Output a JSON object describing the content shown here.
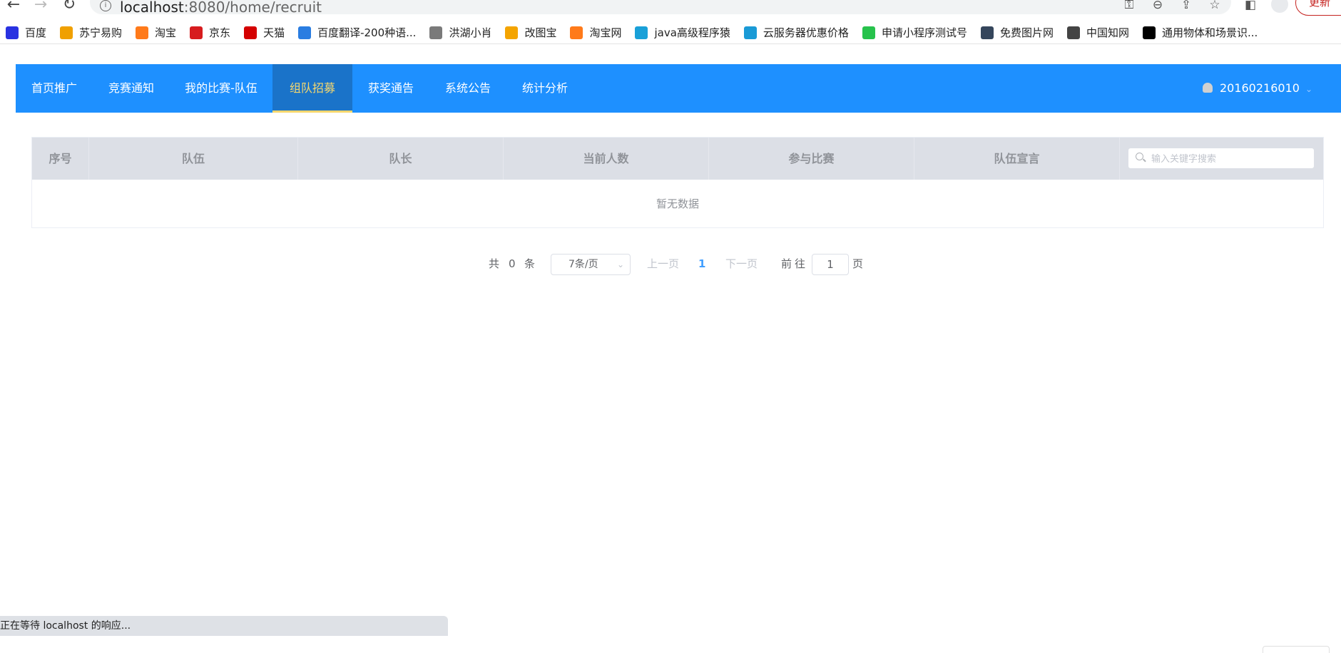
{
  "browser": {
    "url_host": "localhost",
    "url_path": ":8080/home/recruit",
    "update_label": "更新",
    "status_text": "正在等待 localhost 的响应..."
  },
  "bookmarks": [
    {
      "label": "百度",
      "icon": "baidu-icon",
      "color": "#2932e1"
    },
    {
      "label": "苏宁易购",
      "icon": "suning-icon",
      "color": "#f0a000"
    },
    {
      "label": "淘宝",
      "icon": "taobao-icon",
      "color": "#ff7a1a"
    },
    {
      "label": "京东",
      "icon": "jd-icon",
      "color": "#d71c1e"
    },
    {
      "label": "天猫",
      "icon": "tmall-icon",
      "color": "#d40000"
    },
    {
      "label": "百度翻译-200种语...",
      "icon": "translate-icon",
      "color": "#2a7de1"
    },
    {
      "label": "洪湖小肖",
      "icon": "hunhu-icon",
      "color": "#7a7a7a"
    },
    {
      "label": "改图宝",
      "icon": "gaitubao-icon",
      "color": "#f4a400"
    },
    {
      "label": "淘宝网",
      "icon": "taobao-net-icon",
      "color": "#ff7a1a"
    },
    {
      "label": "java高级程序猿",
      "icon": "bilibili-icon",
      "color": "#19a0d8"
    },
    {
      "label": "云服务器优惠价格",
      "icon": "cloud-icon",
      "color": "#1a9ad6"
    },
    {
      "label": "申请小程序测试号",
      "icon": "wechat-icon",
      "color": "#27c24c"
    },
    {
      "label": "免费图片网",
      "icon": "tumblr-icon",
      "color": "#35465c"
    },
    {
      "label": "中国知网",
      "icon": "cnki-icon",
      "color": "#444444"
    },
    {
      "label": "通用物体和场景识...",
      "icon": "ai-icon",
      "color": "#000000"
    }
  ],
  "nav": {
    "items": [
      "首页推广",
      "竞赛通知",
      "我的比赛-队伍",
      "组队招募",
      "获奖通告",
      "系统公告",
      "统计分析"
    ],
    "active": "组队招募",
    "user": "20160216010"
  },
  "table": {
    "columns": [
      "序号",
      "队伍",
      "队长",
      "当前人数",
      "参与比赛",
      "队伍宣言"
    ],
    "search_placeholder": "输入关键字搜索",
    "empty_text": "暂无数据"
  },
  "pagination": {
    "total_prefix": "共",
    "total": "0",
    "total_suffix": "条",
    "page_size": "7条/页",
    "prev": "上一页",
    "current": "1",
    "next": "下一页",
    "goto_prefix": "前往",
    "goto_value": "1",
    "goto_suffix": "页"
  },
  "colors": {
    "nav_bg": "#1e90ff",
    "nav_active_bg": "#1a73c9",
    "nav_active_text": "#f5d76e",
    "header_bg": "#dcdfe6",
    "pager_current": "#409eff"
  }
}
